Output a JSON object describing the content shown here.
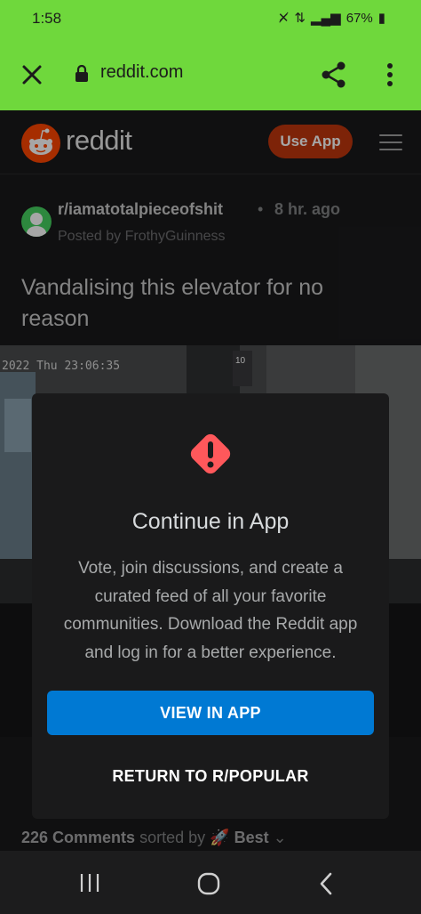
{
  "status_bar": {
    "time": "1:58",
    "battery": "67%"
  },
  "browser": {
    "url": "reddit.com"
  },
  "reddit_header": {
    "wordmark": "reddit",
    "use_app_label": "Use App"
  },
  "post": {
    "subreddit": "r/iamatotalpieceofshit",
    "separator": "•",
    "age": "8 hr. ago",
    "posted_by": "Posted by FrothyGuinness",
    "title": "Vandalising this elevator for no reason",
    "video_timestamp": "2022 Thu 23:06:35",
    "floor_indicator": "10"
  },
  "comments_bar": {
    "count": "226 Comments",
    "sorted_by": "sorted by",
    "sort": "Best"
  },
  "modal": {
    "title": "Continue in App",
    "body": "Vote, join discussions, and create a curated feed of all your favorite communities. Download the Reddit app and log in for a better experience.",
    "primary_label": "VIEW IN APP",
    "secondary_label": "RETURN TO R/POPULAR"
  },
  "colors": {
    "browser_bar": "#6fd83c",
    "reddit_orange": "#c0360d",
    "primary_blue": "#0079d3",
    "warn_red": "#ff585b"
  }
}
